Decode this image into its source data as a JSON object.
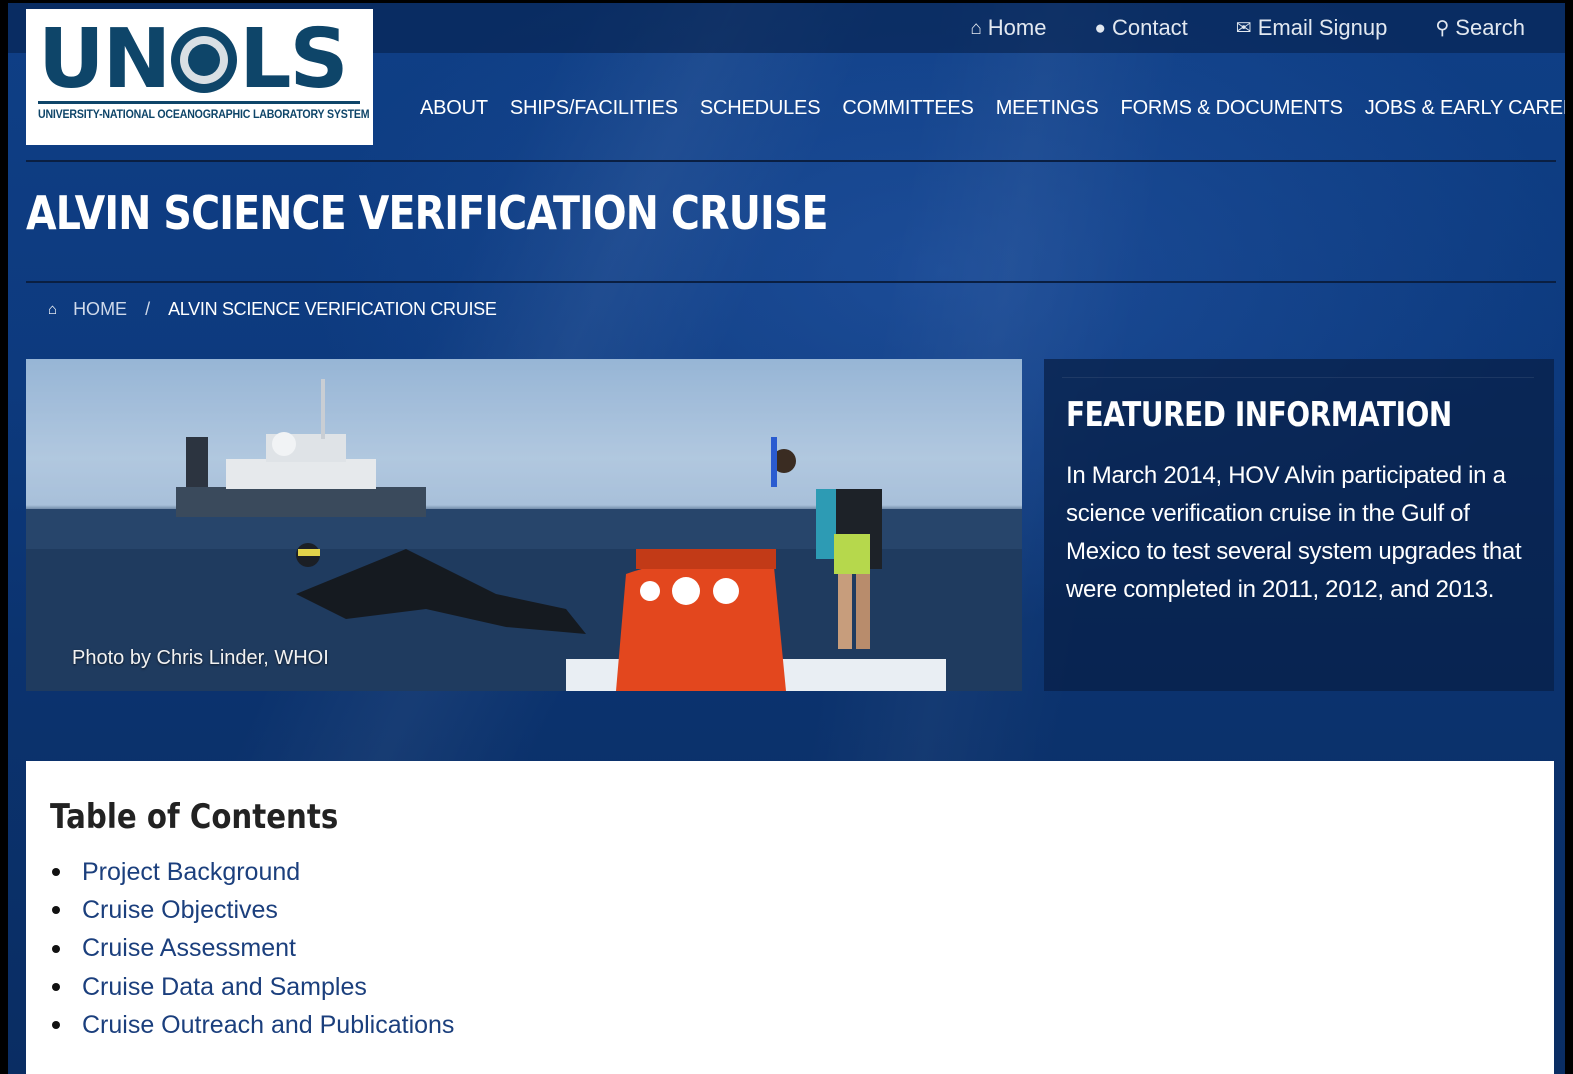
{
  "logo": {
    "letters_left": "UN",
    "letters_right": "LS",
    "subtitle": "UNIVERSITY-NATIONAL OCEANOGRAPHIC LABORATORY SYSTEM"
  },
  "utility_nav": [
    {
      "icon": "home-icon",
      "glyph": "⌂",
      "label": "Home"
    },
    {
      "icon": "chat-icon",
      "glyph": "●",
      "label": "Contact"
    },
    {
      "icon": "envelope-icon",
      "glyph": "✉",
      "label": "Email Signup"
    },
    {
      "icon": "search-icon",
      "glyph": "⚲",
      "label": "Search"
    }
  ],
  "main_nav": [
    "ABOUT",
    "SHIPS/FACILITIES",
    "SCHEDULES",
    "COMMITTEES",
    "MEETINGS",
    "FORMS & DOCUMENTS",
    "JOBS & EARLY CAREER"
  ],
  "page_title": "ALVIN SCIENCE VERIFICATION CRUISE",
  "breadcrumb": {
    "home": "HOME",
    "separator": "/",
    "current": "ALVIN SCIENCE VERIFICATION CRUISE"
  },
  "hero": {
    "photo_credit": "Photo by Chris Linder, WHOI"
  },
  "featured": {
    "title": "FEATURED INFORMATION",
    "body": "In March 2014, HOV Alvin participated in a science verification cruise in the Gulf of Mexico to test several system upgrades that were completed in 2011, 2012, and 2013."
  },
  "toc": {
    "title": "Table of Contents",
    "items": [
      "Project Background",
      "Cruise Objectives",
      "Cruise Assessment",
      "Cruise Data and Samples",
      "Cruise Outreach and Publications"
    ]
  },
  "colors": {
    "brand": "#0e4569",
    "background": "#0d3a7e",
    "link": "#1b3f7d"
  }
}
